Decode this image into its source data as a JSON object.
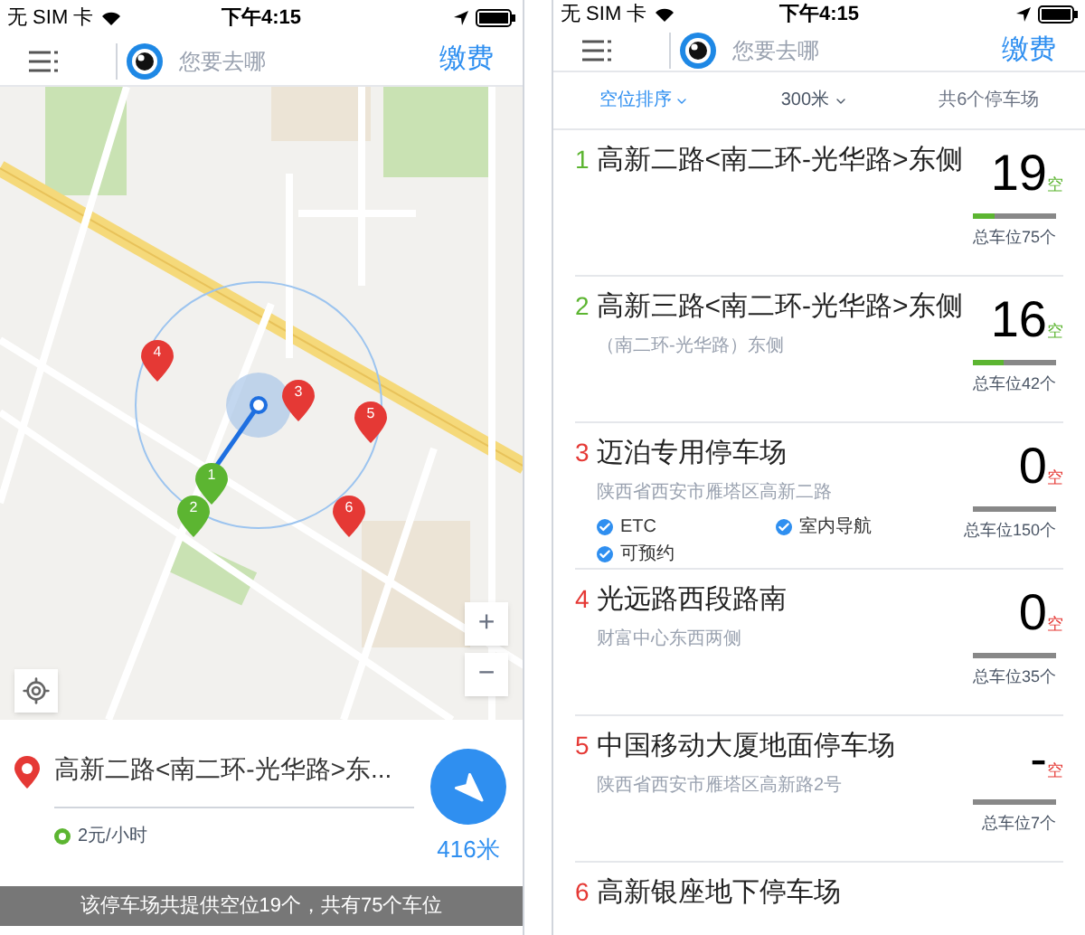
{
  "left_screen": {
    "status_bar": {
      "carrier": "无 SIM 卡",
      "time": "下午4:15"
    },
    "header": {
      "search_placeholder": "您要去哪",
      "pay_button": "缴费"
    },
    "map": {
      "markers": [
        {
          "label": "4",
          "color": "#e53935"
        },
        {
          "label": "3",
          "color": "#e53935"
        },
        {
          "label": "5",
          "color": "#e53935"
        },
        {
          "label": "1",
          "color": "#5cb531"
        },
        {
          "label": "2",
          "color": "#5cb531"
        },
        {
          "label": "6",
          "color": "#e53935"
        }
      ],
      "zoom_in": "+",
      "zoom_out": "−"
    },
    "selected_lot": {
      "name": "高新二路<南二环-光华路>东...",
      "price": "2元/小时",
      "distance": "416米"
    },
    "footer": "该停车场共提供空位19个，共有75个车位"
  },
  "right_screen": {
    "status_bar": {
      "carrier": "无 SIM 卡",
      "time": "下午4:15"
    },
    "header": {
      "search_placeholder": "您要去哪",
      "pay_button": "缴费"
    },
    "filters": [
      {
        "label": "空位排序",
        "selected": true
      },
      {
        "label": "300米",
        "selected": false
      }
    ],
    "lot_count": "共6个停车场",
    "lots": [
      {
        "index": "1",
        "name": "高新二路<南二环-光华路>东侧",
        "available": "19",
        "unit": "空",
        "total": "总车位75个",
        "level": 0.25,
        "color": "#5cb531"
      },
      {
        "index": "2",
        "name": "高新三路<南二环-光华路>东侧",
        "address": "（南二环-光华路）东侧",
        "available": "16",
        "unit": "空",
        "total": "总车位42个",
        "level": 0.38,
        "color": "#5cb531"
      },
      {
        "index": "3",
        "name": "迈泊专用停车场",
        "address": "陕西省西安市雁塔区高新二路",
        "features": [
          "ETC",
          "室内导航",
          "可预约"
        ],
        "available": "0",
        "unit": "空",
        "total": "总车位150个",
        "color": "#e53935"
      },
      {
        "index": "4",
        "name": "光远路西段路南",
        "address": "财富中心东西两侧",
        "available": "0",
        "unit": "空",
        "total": "总车位35个",
        "color": "#e53935"
      },
      {
        "index": "5",
        "name": "中国移动大厦地面停车场",
        "address": "陕西省西安市雁塔区高新路2号",
        "available": "-",
        "unit": "空",
        "total": "总车位7个",
        "color": "#e53935"
      },
      {
        "index": "6",
        "name": "高新银座地下停车场",
        "color": "#e53935"
      }
    ]
  }
}
